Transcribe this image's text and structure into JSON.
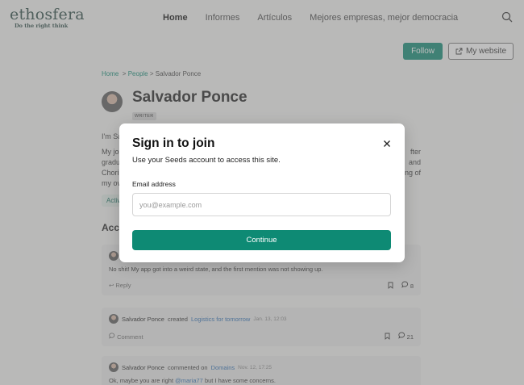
{
  "logo": {
    "wordmark": "ethosfera",
    "tagline": "Do the right think"
  },
  "nav": {
    "items": [
      "Home",
      "Informes",
      "Artículos",
      "Mejores empresas, mejor democracia"
    ],
    "active": "Home"
  },
  "actions": {
    "follow": "Follow",
    "website": "My website"
  },
  "breadcrumb": {
    "home": "Home",
    "sep1": ">",
    "people": "People",
    "sep2": ">",
    "current": "Salvador Ponce"
  },
  "profile": {
    "name": "Salvador Ponce",
    "role": "WRITER"
  },
  "bio": {
    "line1": "I'm Sa",
    "p2_line1": "My jo",
    "p2_line1_end": "fter",
    "p2_line2": "gradu",
    "p2_line2_end": "and",
    "p2_line3": "Chori",
    "p2_line3_end": "ng of",
    "p2_line4": "my ov"
  },
  "active_chip": "Activ",
  "activity_title": "Acc",
  "cards": [
    {
      "body": "No shit! My app got into a weird state, and the first mention was not showing up.",
      "action": "Reply",
      "comments": "8"
    },
    {
      "author": "Salvador Ponce",
      "verb": "created",
      "target": "Logistics for tomorrow",
      "time": "Jan. 13, 12:03",
      "action": "Comment",
      "comments": "21"
    },
    {
      "author": "Salvador Ponce",
      "verb": "commented on",
      "target": "Domains",
      "time": "Nov. 12, 17:25",
      "body_start": "Ok, maybe you are right",
      "mention": "@maria77",
      "body_end": "but I have some concerns."
    }
  ],
  "modal": {
    "title": "Sign in to join",
    "subtitle": "Use your Seeds account to access this site.",
    "email_label": "Email address",
    "email_placeholder": "you@example.com",
    "email_value": "",
    "continue": "Continue"
  },
  "colors": {
    "accent": "#0e8a74",
    "link": "#2c6fb5",
    "overlay": "rgba(120,120,120,0.48)"
  }
}
